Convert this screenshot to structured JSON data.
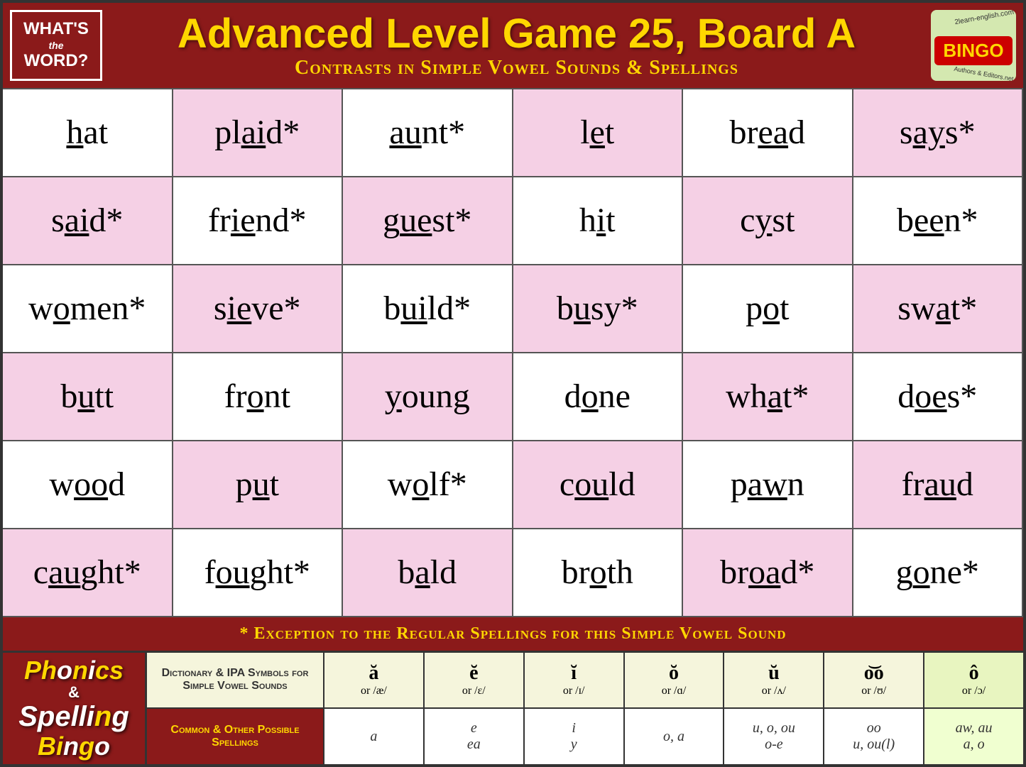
{
  "header": {
    "logo_left_line1": "WHAT'S",
    "logo_left_line2": "the",
    "logo_left_line3": "WORD?",
    "title": "Advanced Level Game 25, Board A",
    "subtitle": "Contrasts in Simple Vowel Sounds & Spellings",
    "logo_right_bingo": "BINGO",
    "logo_right_site1": "2learn-english.com",
    "logo_right_site2": "Authors & Editors.net"
  },
  "grid": {
    "rows": [
      [
        "hat",
        "plaid*",
        "aunt*",
        "let",
        "bread",
        "says*"
      ],
      [
        "said*",
        "friend*",
        "guest*",
        "hit",
        "cyst",
        "been*"
      ],
      [
        "women*",
        "sieve*",
        "build*",
        "busy*",
        "pot",
        "swat*"
      ],
      [
        "butt",
        "front",
        "young",
        "done",
        "what*",
        "does*"
      ],
      [
        "wood",
        "put",
        "wolf*",
        "could",
        "pawn",
        "fraud"
      ],
      [
        "caught*",
        "fought*",
        "bald",
        "broth",
        "broad*",
        "gone*"
      ]
    ]
  },
  "footer_note": "* Exception to the Regular Spellings for this Simple Vowel Sound",
  "phonics": {
    "logo_line1": "Phonics",
    "logo_line2": "&",
    "logo_line3": "Spelling",
    "logo_line4": "Bingo",
    "row1_desc": "Dictionary & IPA Symbols for Simple Vowel Sounds",
    "row2_desc": "Common & Other Possible Spellings",
    "symbols": [
      {
        "top": "ă",
        "bottom": "or /æ/"
      },
      {
        "top": "ĕ",
        "bottom": "or /ɛ/"
      },
      {
        "top": "ĭ",
        "bottom": "or /ɪ/"
      },
      {
        "top": "ŏ",
        "bottom": "or /ɑ/"
      },
      {
        "top": "ŭ",
        "bottom": "or /ʌ/"
      },
      {
        "top": "o͝o",
        "bottom": "or /ʊ/"
      },
      {
        "top": "ô",
        "bottom": "or /ɔ/"
      }
    ],
    "spellings": [
      {
        "line1": "a",
        "line2": ""
      },
      {
        "line1": "e",
        "line2": "ea"
      },
      {
        "line1": "i",
        "line2": "y"
      },
      {
        "line1": "o, a",
        "line2": ""
      },
      {
        "line1": "u, o, ou",
        "line2": "o-e"
      },
      {
        "line1": "oo",
        "line2": "u, ou(l)"
      },
      {
        "line1": "aw, au",
        "line2": "a, o"
      }
    ]
  }
}
